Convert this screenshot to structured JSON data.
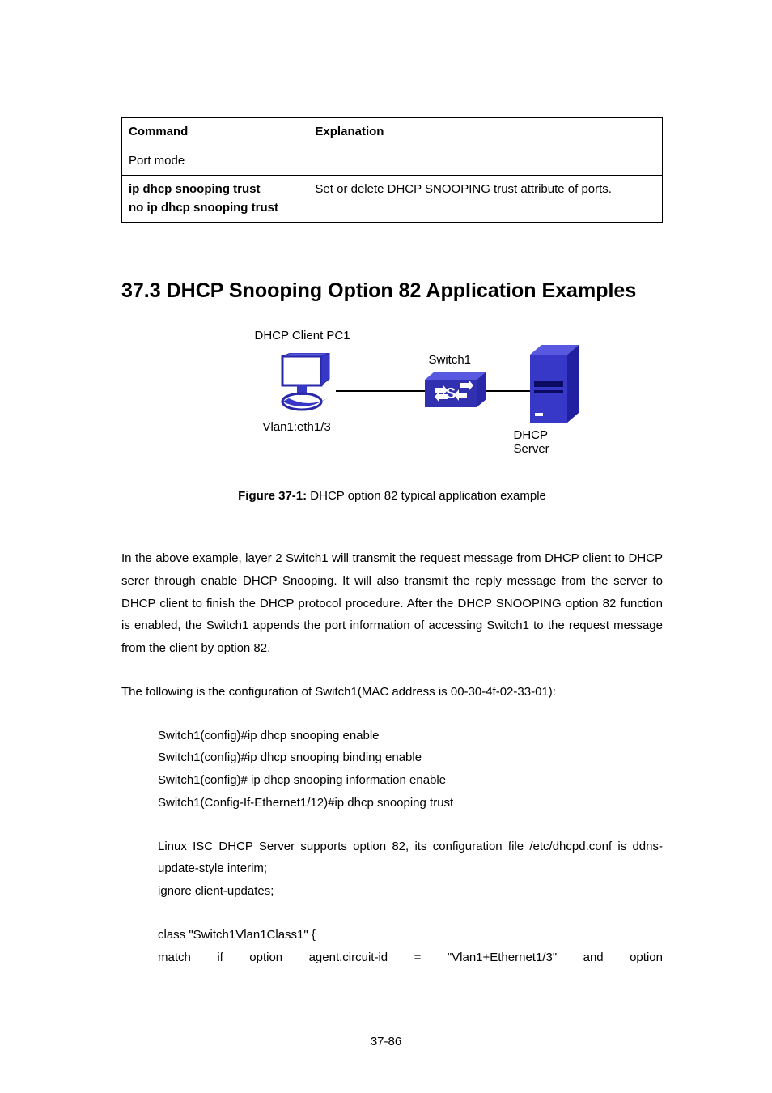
{
  "table": {
    "header": {
      "command": "Command",
      "explanation": "Explanation"
    },
    "port_mode": "Port mode",
    "row2": {
      "cmd1": "ip dhcp snooping trust",
      "cmd2": "no ip dhcp snooping trust",
      "exp": "Set or delete DHCP SNOOPING trust attribute of ports."
    }
  },
  "heading": "37.3 DHCP Snooping Option 82 Application Examples",
  "diagram": {
    "pc": "DHCP Client PC1",
    "switch": "Switch1",
    "vlan": "Vlan1:eth1/3",
    "server": "DHCP Server"
  },
  "figure": {
    "label": "Figure 37-1:",
    "text": " DHCP option 82 typical application example"
  },
  "para1": "In the above example, layer 2 Switch1 will transmit the request message from DHCP client to DHCP serer through enable DHCP Snooping. It will also transmit the reply message from the server to DHCP client to finish the DHCP protocol procedure. After the DHCP SNOOPING option 82 function is enabled, the Switch1 appends the port information of accessing Switch1 to the request message from the client by option 82.",
  "para2": "The following is the configuration of Switch1(MAC address is 00-30-4f-02-33-01):",
  "config": [
    "Switch1(config)#ip dhcp snooping enable",
    "Switch1(config)#ip dhcp snooping binding enable",
    "Switch1(config)# ip dhcp snooping information enable",
    "Switch1(Config-If-Ethernet1/12)#ip dhcp snooping trust"
  ],
  "linux": [
    "Linux ISC DHCP Server supports option 82, its configuration file /etc/dhcpd.conf is ddns-update-style interim;",
    "ignore client-updates;"
  ],
  "class_line": "class \"Switch1Vlan1Class1\" {",
  "match": [
    "match",
    "if",
    "option",
    "agent.circuit-id",
    "=",
    "\"Vlan1+Ethernet1/3\"",
    "and",
    "option"
  ],
  "page_num": "37-86"
}
